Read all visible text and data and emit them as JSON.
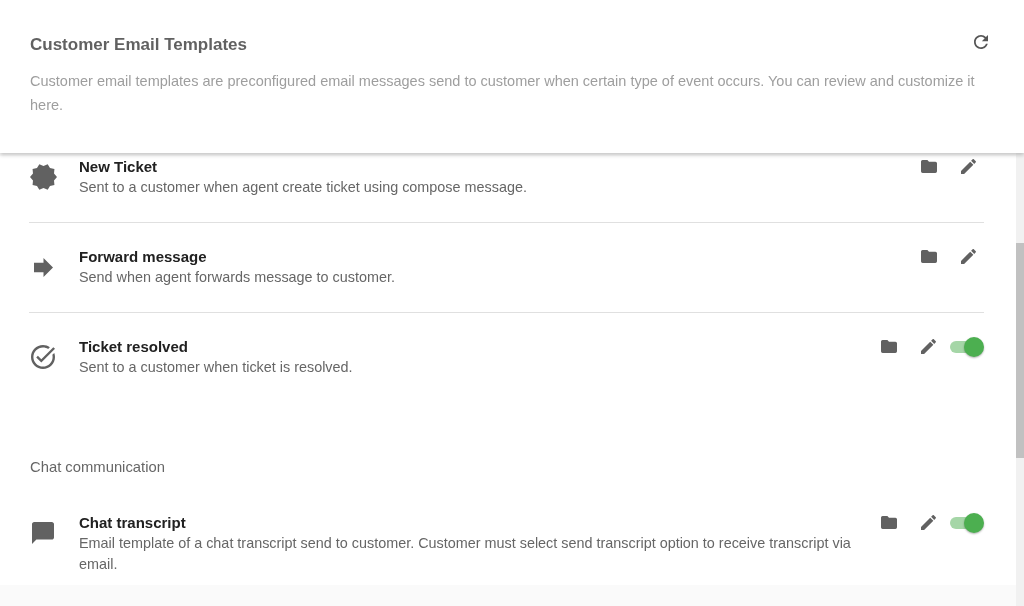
{
  "header": {
    "title": "Customer Email Templates",
    "description": "Customer email templates are preconfigured email messages send to customer when certain type of event occurs. You can review and customize it here."
  },
  "sections": [
    {
      "templates": [
        {
          "kind": "fixed",
          "name": "New Ticket",
          "description": "Sent to a customer when agent create ticket using compose message."
        },
        {
          "kind": "fixed",
          "name": "Forward message",
          "description": "Send when agent forwards message to customer."
        },
        {
          "kind": "switchable",
          "name": "Ticket resolved",
          "description": "Sent to a customer when ticket is resolved.",
          "on": true
        }
      ]
    },
    {
      "label": "Chat communication",
      "templates": [
        {
          "kind": "switchable",
          "name": "Chat transcript",
          "description": "Email template of a chat transcript send to customer. Customer must select send transcript option to receive transcript via email.",
          "on": true
        }
      ]
    }
  ]
}
